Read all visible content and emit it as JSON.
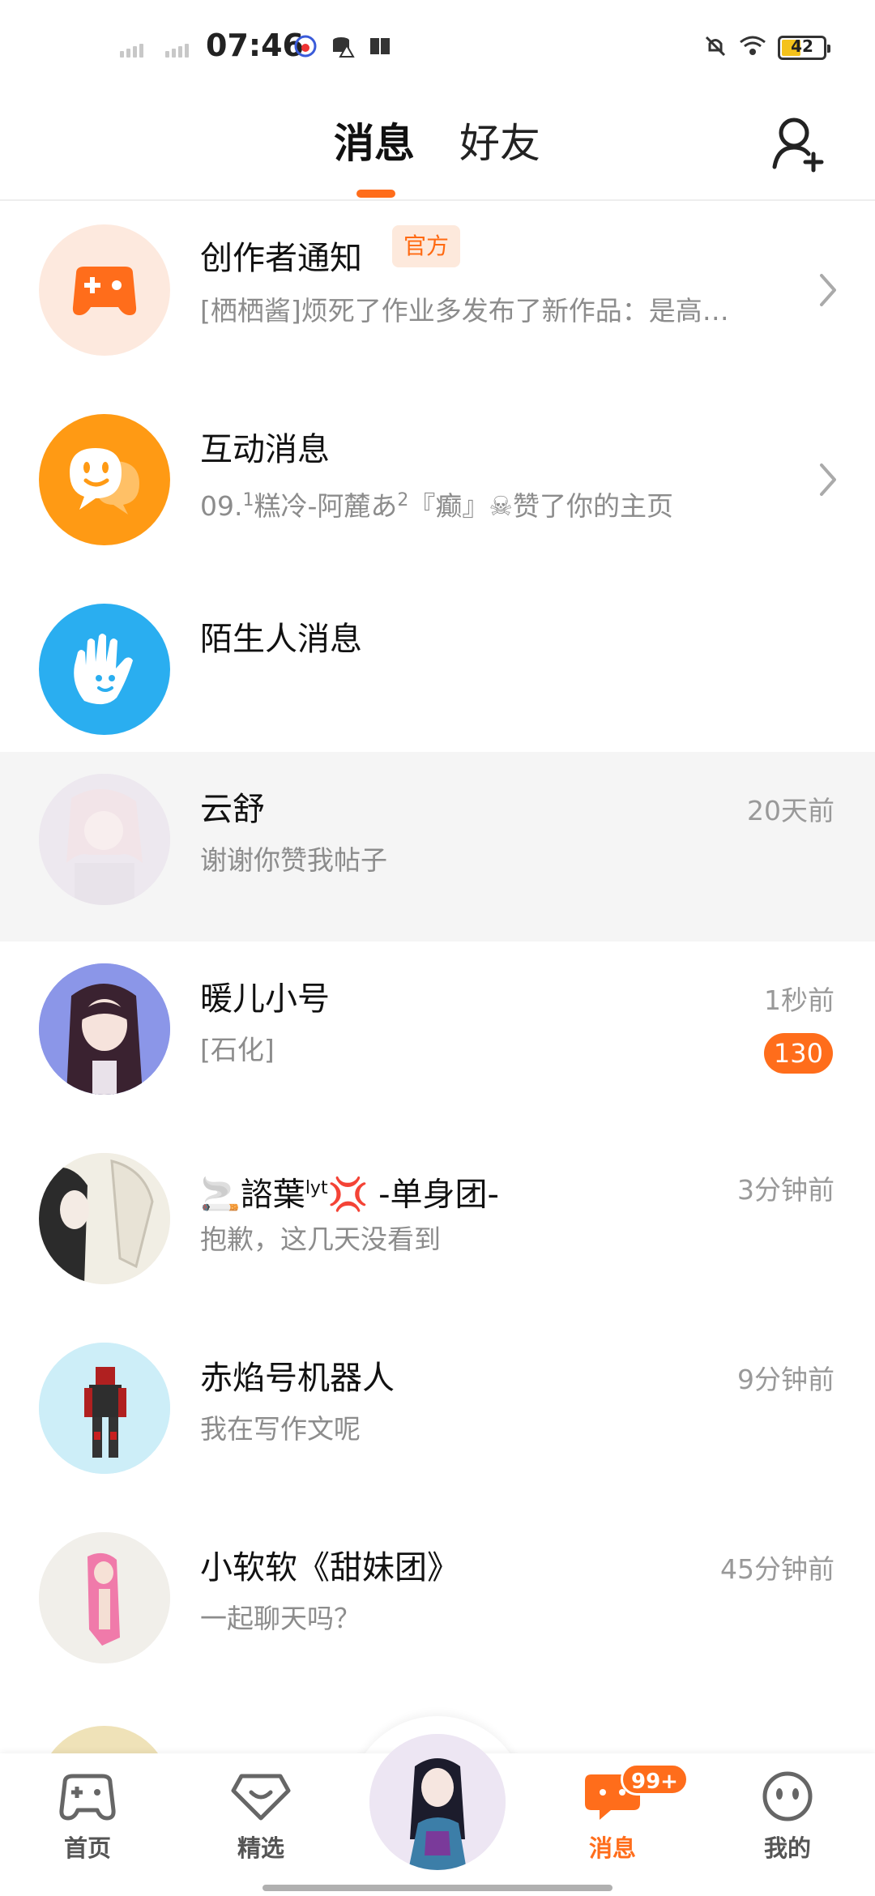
{
  "status_bar": {
    "time": "07:46",
    "battery": "42",
    "icons": [
      "baidu-icon",
      "data-alert-icon",
      "book-icon",
      "mute-icon",
      "wifi-icon",
      "battery-icon"
    ]
  },
  "header": {
    "tabs": [
      {
        "label": "消息",
        "active": true
      },
      {
        "label": "好友",
        "active": false
      }
    ],
    "add_friend_icon": "add-user-icon"
  },
  "system_items": [
    {
      "title": "创作者通知",
      "tag": "官方",
      "subtitle": "[栖栖酱]烦死了作业多发布了新作品：是高…",
      "icon": "gamepad-icon",
      "color": "#ff6d1b"
    },
    {
      "title": "互动消息",
      "subtitle_a": "09.",
      "subtitle_b": "1",
      "subtitle_c": "糕冷-阿麓あ",
      "subtitle_d": "2",
      "subtitle_e": "『癫』☠赞了你的主页",
      "icon": "smile-bubble-icon",
      "color": "#ff9a14"
    },
    {
      "title": "陌生人消息",
      "icon": "hand-wave-icon",
      "color": "#2aaef0"
    }
  ],
  "conversations": [
    {
      "name": "云舒",
      "message": "谢谢你赞我帖子",
      "time": "20天前"
    },
    {
      "name": "暖儿小号",
      "message": "[石化]",
      "time": "1秒前",
      "unread": "130"
    },
    {
      "name_a": "🚬諮葉",
      "name_b": "lyt",
      "name_c": "💢 -单身团-",
      "message": "抱歉，这几天没看到",
      "time": "3分钟前"
    },
    {
      "name": "赤焰号机器人",
      "message": "我在写作文呢",
      "time": "9分钟前"
    },
    {
      "name": "小软软《甜妹团》",
      "message": "一起聊天吗？",
      "time": "45分钟前"
    }
  ],
  "bottom_nav": [
    {
      "label": "首页",
      "icon": "gamepad-icon"
    },
    {
      "label": "精选",
      "icon": "heart-diamond-icon"
    },
    {
      "label": "",
      "icon": "avatar"
    },
    {
      "label": "消息",
      "icon": "message-icon",
      "badge": "99+",
      "active": true
    },
    {
      "label": "我的",
      "icon": "face-icon"
    }
  ],
  "colors": {
    "accent": "#ff6d1b",
    "highlight_row": "#f5f5f5"
  }
}
